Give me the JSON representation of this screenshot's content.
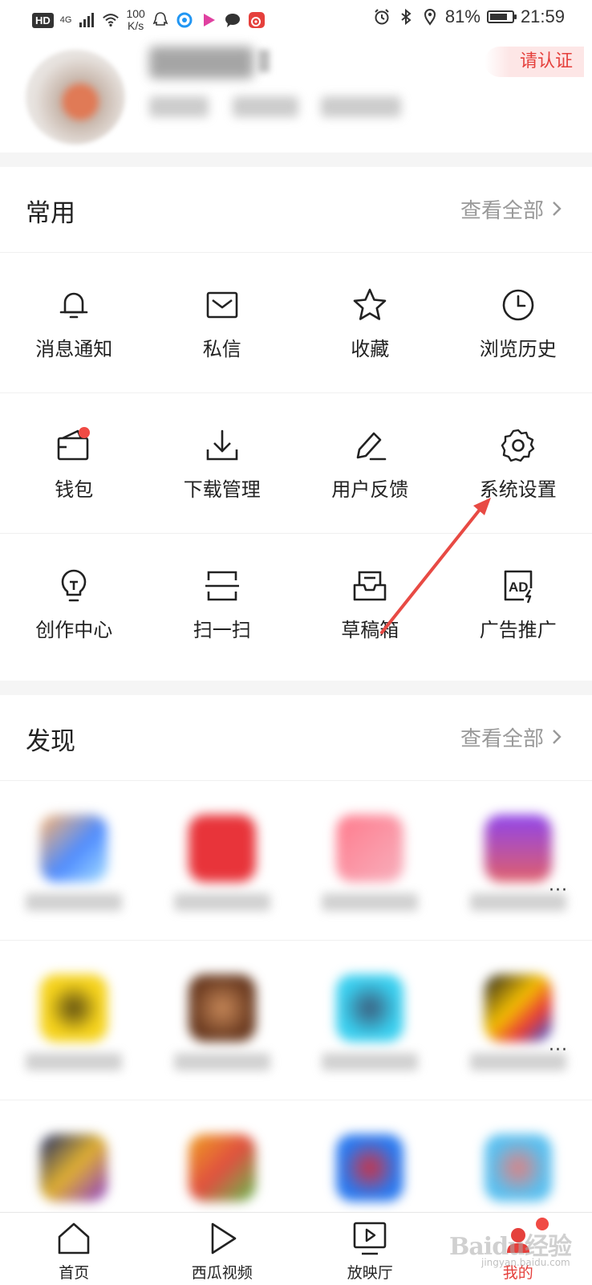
{
  "status_bar": {
    "hd": "HD",
    "network": "4G",
    "speed_value": "100",
    "speed_unit": "K/s",
    "battery_percent": "81%",
    "battery_level": 0.81,
    "time": "21:59"
  },
  "profile": {
    "verify_label": "请认证"
  },
  "common": {
    "title": "常用",
    "see_all": "查看全部",
    "rows": [
      [
        {
          "label": "消息通知",
          "icon": "bell-icon"
        },
        {
          "label": "私信",
          "icon": "mail-icon"
        },
        {
          "label": "收藏",
          "icon": "star-icon"
        },
        {
          "label": "浏览历史",
          "icon": "clock-icon"
        }
      ],
      [
        {
          "label": "钱包",
          "icon": "wallet-icon"
        },
        {
          "label": "下载管理",
          "icon": "download-icon"
        },
        {
          "label": "用户反馈",
          "icon": "pen-icon"
        },
        {
          "label": "系统设置",
          "icon": "gear-icon"
        }
      ],
      [
        {
          "label": "创作中心",
          "icon": "lightbulb-icon"
        },
        {
          "label": "扫一扫",
          "icon": "scan-icon"
        },
        {
          "label": "草稿箱",
          "icon": "drafts-icon"
        },
        {
          "label": "广告推广",
          "icon": "ad-icon"
        }
      ]
    ]
  },
  "discover": {
    "title": "发现",
    "see_all": "查看全部"
  },
  "tabs": [
    {
      "label": "首页",
      "icon": "home-icon"
    },
    {
      "label": "西瓜视频",
      "icon": "play-icon"
    },
    {
      "label": "放映厅",
      "icon": "tv-icon"
    },
    {
      "label": "我的",
      "icon": "profile-icon"
    }
  ],
  "watermark": {
    "logo": "Baidu经验",
    "url": "jingyan.baidu.com"
  },
  "colors": {
    "accent": "#e5403c",
    "badge": "#f04a44",
    "annotation_arrow": "#e84a44"
  }
}
